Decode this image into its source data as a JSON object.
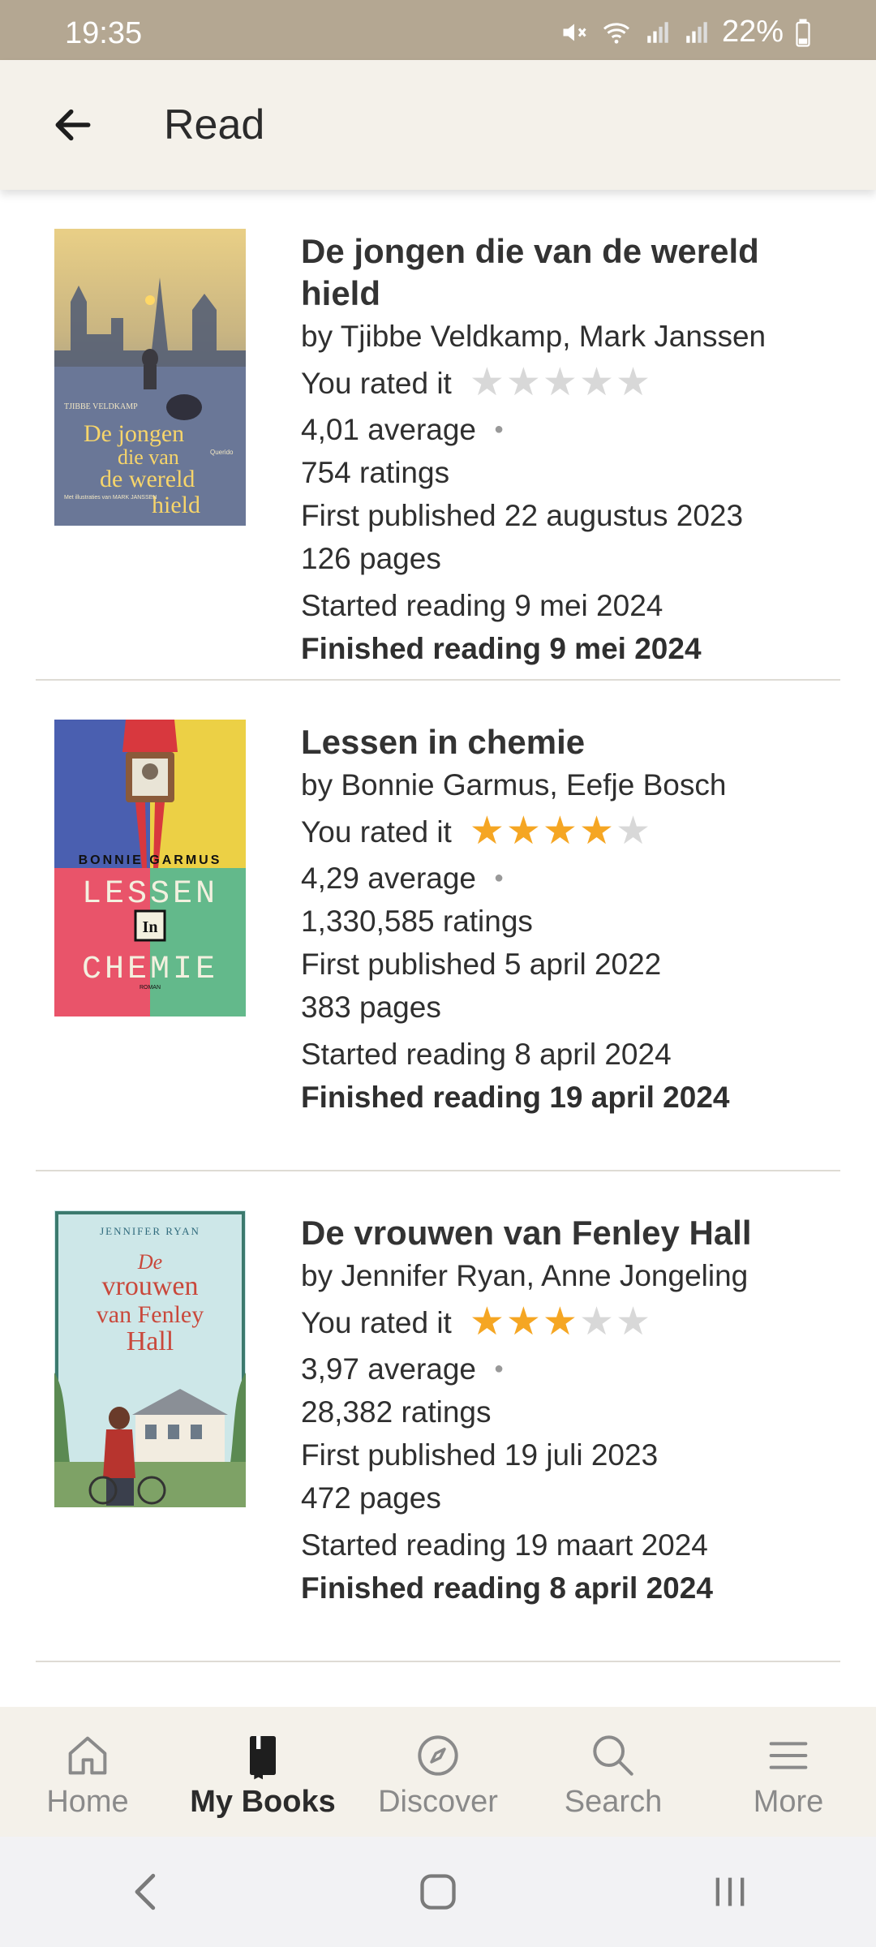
{
  "status_bar": {
    "time": "19:35",
    "battery": "22%"
  },
  "header": {
    "title": "Read"
  },
  "books": [
    {
      "title": "De jongen die van de wereld hield",
      "authors": "by Tjibbe Veldkamp, Mark Janssen",
      "rated_label": "You rated it",
      "rating": 0,
      "average": "4,01 average",
      "ratings_count": "754 ratings",
      "first_published": "First published 22 augustus 2023",
      "pages": "126 pages",
      "started": "Started reading 9 mei 2024",
      "finished": "Finished reading 9 mei 2024",
      "cover": {
        "author_text": "TJIBBE VELDKAMP",
        "title_lines": [
          "De jongen",
          "die van",
          "de wereld",
          "hield"
        ],
        "credit": "Met illustraties van MARK JANSSEN",
        "publisher": "Querido"
      }
    },
    {
      "title": "Lessen in chemie",
      "authors": "by Bonnie Garmus, Eefje Bosch",
      "rated_label": "You rated it",
      "rating": 4,
      "average": "4,29 average",
      "ratings_count": "1,330,585 ratings",
      "first_published": "First published 5 april 2022",
      "pages": "383 pages",
      "started": "Started reading 8 april 2024",
      "finished": "Finished reading 19 april 2024",
      "cover": {
        "author_text": "BONNIE GARMUS",
        "title_top": "LESSEN",
        "title_mid": "In",
        "title_bottom": "CHEMIE",
        "genre": "ROMAN"
      }
    },
    {
      "title": "De vrouwen van Fenley Hall",
      "authors": "by Jennifer Ryan, Anne Jongeling",
      "rated_label": "You rated it",
      "rating": 3,
      "average": "3,97 average",
      "ratings_count": "28,382 ratings",
      "first_published": "First published 19 juli 2023",
      "pages": "472 pages",
      "started": "Started reading 19 maart 2024",
      "finished": "Finished reading 8 april 2024",
      "cover": {
        "author_text": "JENNIFER RYAN",
        "title_lines": [
          "De",
          "vrouwen",
          "van Fenley",
          "Hall"
        ]
      }
    }
  ],
  "bottom_nav": [
    {
      "label": "Home",
      "icon": "home-icon",
      "active": false
    },
    {
      "label": "My Books",
      "icon": "my-books-icon",
      "active": true
    },
    {
      "label": "Discover",
      "icon": "compass-icon",
      "active": false
    },
    {
      "label": "Search",
      "icon": "search-icon",
      "active": false
    },
    {
      "label": "More",
      "icon": "menu-icon",
      "active": false
    }
  ],
  "colors": {
    "star_on": "#f5a623",
    "star_off": "#d8d8d8",
    "status_bar": "#b4a792",
    "app_bar": "#f4f1ea"
  }
}
